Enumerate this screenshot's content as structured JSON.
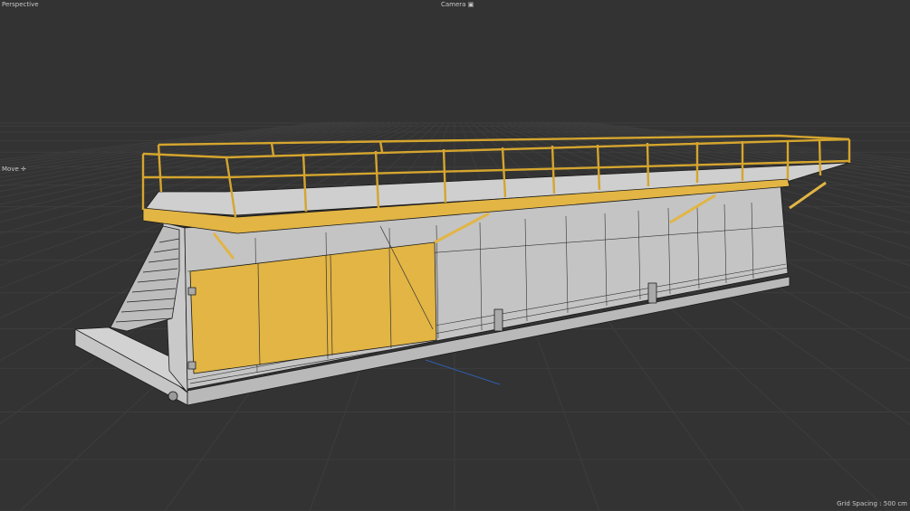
{
  "viewport": {
    "view_name": "Perspective",
    "camera_name": "Camera",
    "camera_icon": "camera-icon",
    "active_tool": "Move",
    "tool_icon": "move-icon",
    "grid_spacing_label": "Grid Spacing : 500 cm"
  },
  "colors": {
    "background": "#333333",
    "grid_line": "#3d3d3d",
    "body_fill": "#c4c4c4",
    "wireframe": "#1a1a1a",
    "selection_yellow": "#e7b43a",
    "axis_blue": "#2f5fb0"
  },
  "model": {
    "type": "skid-mounted-container-platform",
    "selected_parts": [
      "guard-rail",
      "platform-deck-edge",
      "roll-up-door"
    ]
  }
}
